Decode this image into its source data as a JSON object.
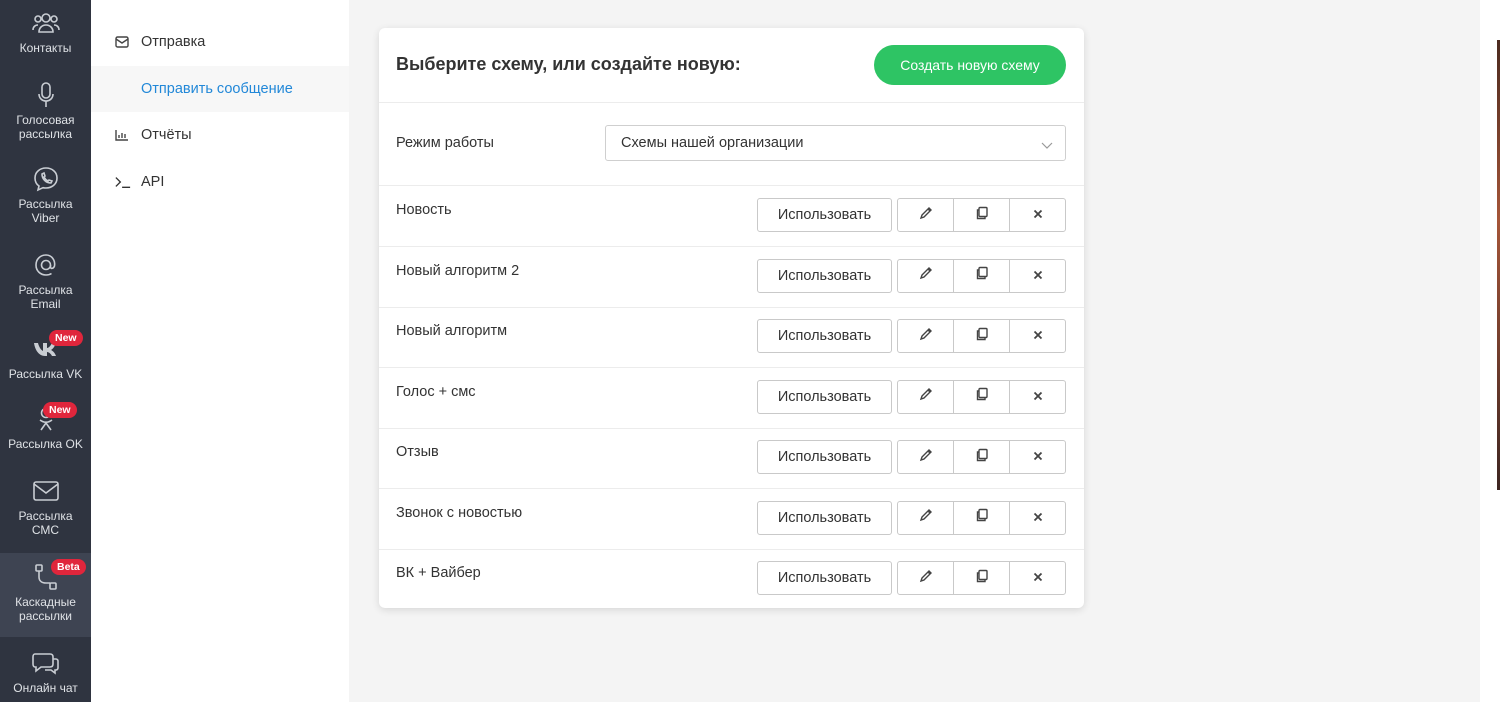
{
  "rail": {
    "items": [
      {
        "label": "Контакты",
        "icon": "contacts-icon"
      },
      {
        "label": "Голосовая рассылка",
        "icon": "microphone-icon"
      },
      {
        "label": "Рассылка Viber",
        "icon": "viber-icon"
      },
      {
        "label": "Рассылка Email",
        "icon": "at-sign-icon"
      },
      {
        "label": "Рассылка VK",
        "icon": "vk-icon",
        "badge": "New"
      },
      {
        "label": "Рассылка OK",
        "icon": "ok-icon",
        "badge": "New"
      },
      {
        "label": "Рассылка СМС",
        "icon": "envelope-icon"
      },
      {
        "label": "Каскадные рассылки",
        "icon": "cascade-icon",
        "badge": "Beta",
        "active": true
      },
      {
        "label": "Онлайн чат",
        "icon": "chat-icon"
      }
    ]
  },
  "subnav": {
    "send": "Отправка",
    "send_message": "Отправить сообщение",
    "reports": "Отчёты",
    "api": "API"
  },
  "card": {
    "title": "Выберите схему, или создайте новую:",
    "create_button": "Создать новую схему",
    "mode_label": "Режим работы",
    "mode_value": "Схемы нашей организации",
    "use_label": "Использовать",
    "schemes": [
      {
        "name": "Новость"
      },
      {
        "name": "Новый алгоритм 2"
      },
      {
        "name": "Новый алгоритм"
      },
      {
        "name": "Голос + смс"
      },
      {
        "name": "Отзыв"
      },
      {
        "name": "Звонок с новостью"
      },
      {
        "name": "ВК + Вайбер"
      }
    ]
  },
  "colors": {
    "rail_bg": "#2f3440",
    "accent_green": "#2ec464",
    "link_blue": "#2288d8",
    "badge_red": "#e0263c"
  }
}
